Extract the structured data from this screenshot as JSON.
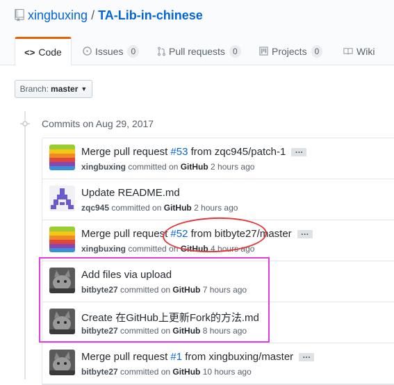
{
  "repo": {
    "owner": "xingbuxing",
    "separator": "/",
    "name": "TA-Lib-in-chinese"
  },
  "tabs": [
    {
      "label": "Code",
      "icon": "<>",
      "counter": null
    },
    {
      "label": "Issues",
      "icon": "issue-icon",
      "counter": "0"
    },
    {
      "label": "Pull requests",
      "icon": "pull-request-icon",
      "counter": "0"
    },
    {
      "label": "Projects",
      "icon": "project-icon",
      "counter": "0"
    },
    {
      "label": "Wiki",
      "icon": "book-icon",
      "counter": null
    }
  ],
  "branch": {
    "prefix": "Branch:",
    "value": "master"
  },
  "group_title": "Commits on Aug 29, 2017",
  "commits": [
    {
      "pre": "Merge pull request ",
      "issue": "#53",
      "post": " from zqc945/patch-1",
      "author": "xingbuxing",
      "committed": " committed on ",
      "platform": "GitHub",
      "time": " 2 hours ago",
      "avatar": "stripes",
      "ellipsis": "…"
    },
    {
      "pre": "Update README.md",
      "issue": "",
      "post": "",
      "author": "zqc945",
      "committed": " committed on ",
      "platform": "GitHub",
      "time": " 2 hours ago",
      "avatar": "identicon",
      "ellipsis": ""
    },
    {
      "pre": "Merge pull request ",
      "issue": "#52",
      "post": " from bitbyte27/master",
      "author": "xingbuxing",
      "committed": " committed on ",
      "platform": "GitHub",
      "time": " 4 hours ago",
      "avatar": "stripes",
      "ellipsis": "…"
    },
    {
      "pre": "Add files via upload",
      "issue": "",
      "post": "",
      "author": "bitbyte27",
      "committed": " committed on ",
      "platform": "GitHub",
      "time": " 7 hours ago",
      "avatar": "cat",
      "ellipsis": ""
    },
    {
      "pre": "Create 在GitHub上更新Fork的方法.md",
      "issue": "",
      "post": "",
      "author": "bitbyte27",
      "committed": " committed on ",
      "platform": "GitHub",
      "time": " 8 hours ago",
      "avatar": "cat",
      "ellipsis": ""
    },
    {
      "pre": "Merge pull request ",
      "issue": "#1",
      "post": " from xingbuxing/master",
      "author": "bitbyte27",
      "committed": " committed on ",
      "platform": "GitHub",
      "time": " 10 hours ago",
      "avatar": "cat",
      "ellipsis": "…"
    }
  ],
  "colors": {
    "link": "#0366d6",
    "selected_tab_accent": "#e36209",
    "annotation_red": "#e0383b",
    "annotation_magenta": "#e33be0"
  }
}
